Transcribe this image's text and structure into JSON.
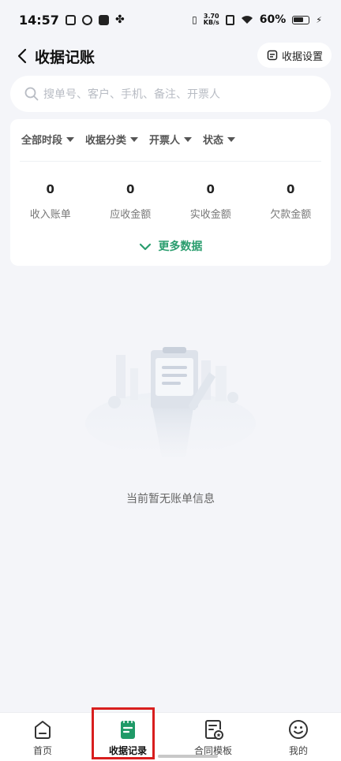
{
  "status_bar": {
    "time": "14:57",
    "net_speed_value": "3.70",
    "net_speed_unit": "KB/s",
    "battery_percent": "60%"
  },
  "header": {
    "title": "收据记账",
    "settings_label": "收据设置"
  },
  "search": {
    "placeholder": "搜单号、客户、手机、备注、开票人"
  },
  "filters": [
    {
      "label": "全部时段"
    },
    {
      "label": "收据分类"
    },
    {
      "label": "开票人"
    },
    {
      "label": "状态"
    }
  ],
  "metrics": [
    {
      "value": "0",
      "label": "收入账单"
    },
    {
      "value": "0",
      "label": "应收金额"
    },
    {
      "value": "0",
      "label": "实收金额"
    },
    {
      "value": "0",
      "label": "欠款金额"
    }
  ],
  "more_data_label": "更多数据",
  "empty_state": {
    "message": "当前暂无账单信息"
  },
  "bottom_nav": [
    {
      "label": "首页",
      "icon": "home-icon"
    },
    {
      "label": "收据记录",
      "icon": "receipt-icon",
      "active": true
    },
    {
      "label": "合同模板",
      "icon": "contract-template-icon"
    },
    {
      "label": "我的",
      "icon": "smiley-icon"
    }
  ],
  "colors": {
    "accent": "#2a9d6e",
    "background": "#f4f5f9",
    "highlight": "#d81e1e"
  }
}
